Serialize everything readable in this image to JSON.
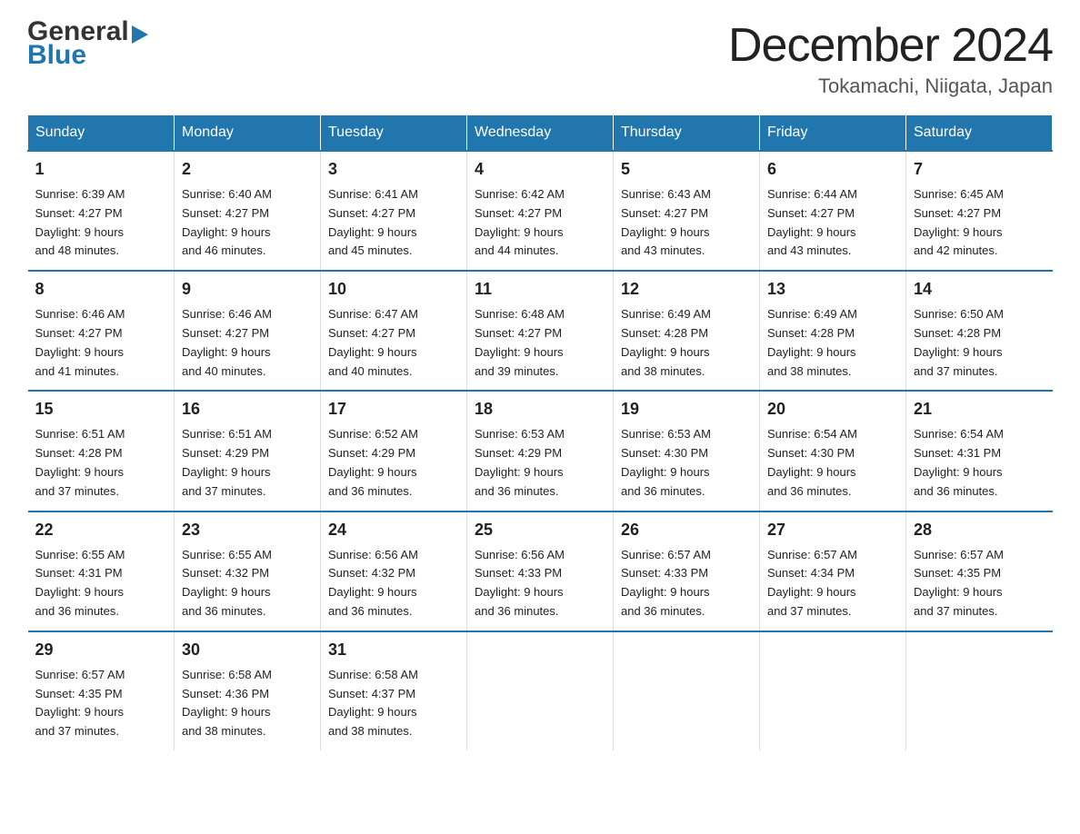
{
  "logo": {
    "text1": "General",
    "text2": "Blue"
  },
  "title": "December 2024",
  "subtitle": "Tokamachi, Niigata, Japan",
  "weekdays": [
    "Sunday",
    "Monday",
    "Tuesday",
    "Wednesday",
    "Thursday",
    "Friday",
    "Saturday"
  ],
  "weeks": [
    [
      {
        "day": "1",
        "sunrise": "6:39 AM",
        "sunset": "4:27 PM",
        "daylight": "9 hours and 48 minutes."
      },
      {
        "day": "2",
        "sunrise": "6:40 AM",
        "sunset": "4:27 PM",
        "daylight": "9 hours and 46 minutes."
      },
      {
        "day": "3",
        "sunrise": "6:41 AM",
        "sunset": "4:27 PM",
        "daylight": "9 hours and 45 minutes."
      },
      {
        "day": "4",
        "sunrise": "6:42 AM",
        "sunset": "4:27 PM",
        "daylight": "9 hours and 44 minutes."
      },
      {
        "day": "5",
        "sunrise": "6:43 AM",
        "sunset": "4:27 PM",
        "daylight": "9 hours and 43 minutes."
      },
      {
        "day": "6",
        "sunrise": "6:44 AM",
        "sunset": "4:27 PM",
        "daylight": "9 hours and 43 minutes."
      },
      {
        "day": "7",
        "sunrise": "6:45 AM",
        "sunset": "4:27 PM",
        "daylight": "9 hours and 42 minutes."
      }
    ],
    [
      {
        "day": "8",
        "sunrise": "6:46 AM",
        "sunset": "4:27 PM",
        "daylight": "9 hours and 41 minutes."
      },
      {
        "day": "9",
        "sunrise": "6:46 AM",
        "sunset": "4:27 PM",
        "daylight": "9 hours and 40 minutes."
      },
      {
        "day": "10",
        "sunrise": "6:47 AM",
        "sunset": "4:27 PM",
        "daylight": "9 hours and 40 minutes."
      },
      {
        "day": "11",
        "sunrise": "6:48 AM",
        "sunset": "4:27 PM",
        "daylight": "9 hours and 39 minutes."
      },
      {
        "day": "12",
        "sunrise": "6:49 AM",
        "sunset": "4:28 PM",
        "daylight": "9 hours and 38 minutes."
      },
      {
        "day": "13",
        "sunrise": "6:49 AM",
        "sunset": "4:28 PM",
        "daylight": "9 hours and 38 minutes."
      },
      {
        "day": "14",
        "sunrise": "6:50 AM",
        "sunset": "4:28 PM",
        "daylight": "9 hours and 37 minutes."
      }
    ],
    [
      {
        "day": "15",
        "sunrise": "6:51 AM",
        "sunset": "4:28 PM",
        "daylight": "9 hours and 37 minutes."
      },
      {
        "day": "16",
        "sunrise": "6:51 AM",
        "sunset": "4:29 PM",
        "daylight": "9 hours and 37 minutes."
      },
      {
        "day": "17",
        "sunrise": "6:52 AM",
        "sunset": "4:29 PM",
        "daylight": "9 hours and 36 minutes."
      },
      {
        "day": "18",
        "sunrise": "6:53 AM",
        "sunset": "4:29 PM",
        "daylight": "9 hours and 36 minutes."
      },
      {
        "day": "19",
        "sunrise": "6:53 AM",
        "sunset": "4:30 PM",
        "daylight": "9 hours and 36 minutes."
      },
      {
        "day": "20",
        "sunrise": "6:54 AM",
        "sunset": "4:30 PM",
        "daylight": "9 hours and 36 minutes."
      },
      {
        "day": "21",
        "sunrise": "6:54 AM",
        "sunset": "4:31 PM",
        "daylight": "9 hours and 36 minutes."
      }
    ],
    [
      {
        "day": "22",
        "sunrise": "6:55 AM",
        "sunset": "4:31 PM",
        "daylight": "9 hours and 36 minutes."
      },
      {
        "day": "23",
        "sunrise": "6:55 AM",
        "sunset": "4:32 PM",
        "daylight": "9 hours and 36 minutes."
      },
      {
        "day": "24",
        "sunrise": "6:56 AM",
        "sunset": "4:32 PM",
        "daylight": "9 hours and 36 minutes."
      },
      {
        "day": "25",
        "sunrise": "6:56 AM",
        "sunset": "4:33 PM",
        "daylight": "9 hours and 36 minutes."
      },
      {
        "day": "26",
        "sunrise": "6:57 AM",
        "sunset": "4:33 PM",
        "daylight": "9 hours and 36 minutes."
      },
      {
        "day": "27",
        "sunrise": "6:57 AM",
        "sunset": "4:34 PM",
        "daylight": "9 hours and 37 minutes."
      },
      {
        "day": "28",
        "sunrise": "6:57 AM",
        "sunset": "4:35 PM",
        "daylight": "9 hours and 37 minutes."
      }
    ],
    [
      {
        "day": "29",
        "sunrise": "6:57 AM",
        "sunset": "4:35 PM",
        "daylight": "9 hours and 37 minutes."
      },
      {
        "day": "30",
        "sunrise": "6:58 AM",
        "sunset": "4:36 PM",
        "daylight": "9 hours and 38 minutes."
      },
      {
        "day": "31",
        "sunrise": "6:58 AM",
        "sunset": "4:37 PM",
        "daylight": "9 hours and 38 minutes."
      },
      null,
      null,
      null,
      null
    ]
  ],
  "labels": {
    "sunrise": "Sunrise:",
    "sunset": "Sunset:",
    "daylight": "Daylight:"
  }
}
